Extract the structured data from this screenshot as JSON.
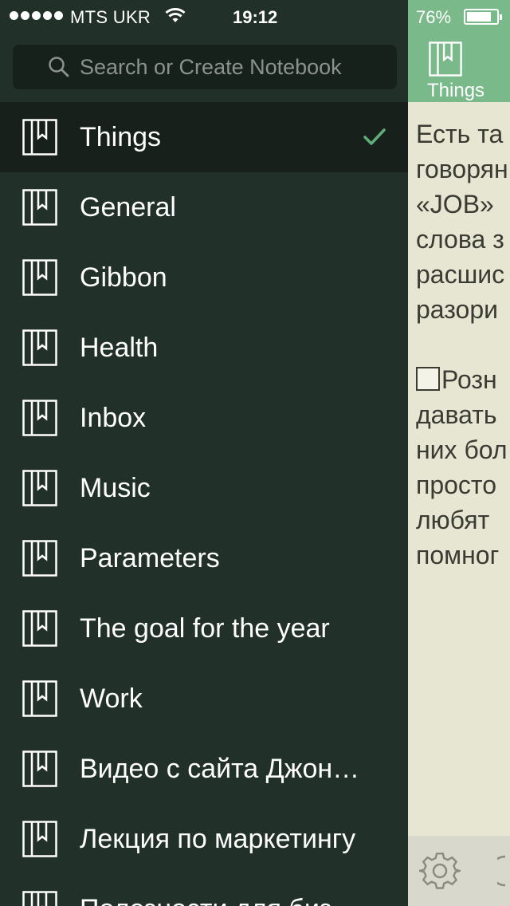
{
  "status_bar": {
    "carrier": "MTS UKR",
    "time": "19:12",
    "battery": "76%",
    "battery_level": 0.76,
    "signal_dots": 5
  },
  "search": {
    "placeholder": "Search or Create Notebook"
  },
  "notebooks": [
    {
      "label": "Things",
      "selected": true
    },
    {
      "label": "General"
    },
    {
      "label": "Gibbon"
    },
    {
      "label": "Health"
    },
    {
      "label": "Inbox"
    },
    {
      "label": "Music"
    },
    {
      "label": "Parameters"
    },
    {
      "label": "The goal for the year"
    },
    {
      "label": "Work"
    },
    {
      "label": "Видео с сайта Джон…"
    },
    {
      "label": "Лекция по маркетингу"
    },
    {
      "label": "Полезности для биз"
    }
  ],
  "note": {
    "notebook_title": "Things",
    "lines": [
      "Есть та",
      "говорян",
      "«JOB»",
      "слова з",
      "расшис",
      "разори"
    ],
    "lines2": [
      "Розн",
      "давать",
      "них бол",
      "просто",
      "любят",
      "помног"
    ]
  },
  "colors": {
    "sidebar_bg": "#22302a",
    "selected_bg": "#17201b",
    "accent_green": "#7ab98a",
    "checkmark": "#5fae77",
    "note_bg": "#e7e6d2"
  },
  "icons": {
    "search": "search-icon",
    "notebook": "notebook-icon",
    "check": "checkmark-icon",
    "settings": "gear-icon"
  }
}
